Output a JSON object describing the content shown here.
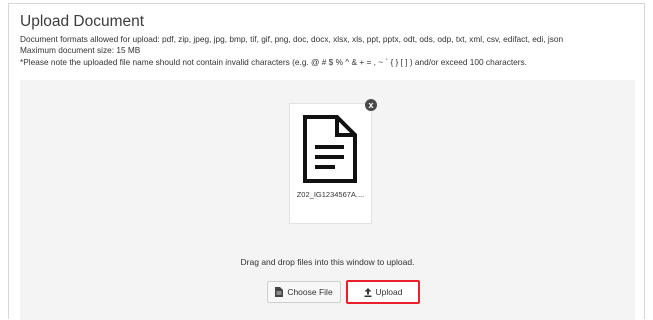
{
  "header": {
    "title": "Upload Document",
    "formats_line": "Document formats allowed for upload: pdf, zip, jpeg, jpg, bmp, tif, gif, png, doc, docx, xlsx, xls, ppt, pptx, odt, ods, odp, txt, xml, csv, edifact, edi, json",
    "max_size_line": "Maximum document size: 15 MB",
    "note_line": "*Please note the uploaded file name should not contain invalid characters (e.g. @ # $ % ^ & + = , ~ ` { } [ ] ) and/or exceed 100 characters."
  },
  "dropzone": {
    "file": {
      "name": "Z02_IG1234567A....",
      "icon": "document-icon",
      "remove_label": "x"
    },
    "instruction": "Drag and drop files into this window to upload.",
    "choose_file_label": "Choose File",
    "choose_file_icon": "file-icon",
    "upload_label": "Upload",
    "upload_icon": "upload-icon",
    "upload_highlight_color": "#e8202a"
  }
}
